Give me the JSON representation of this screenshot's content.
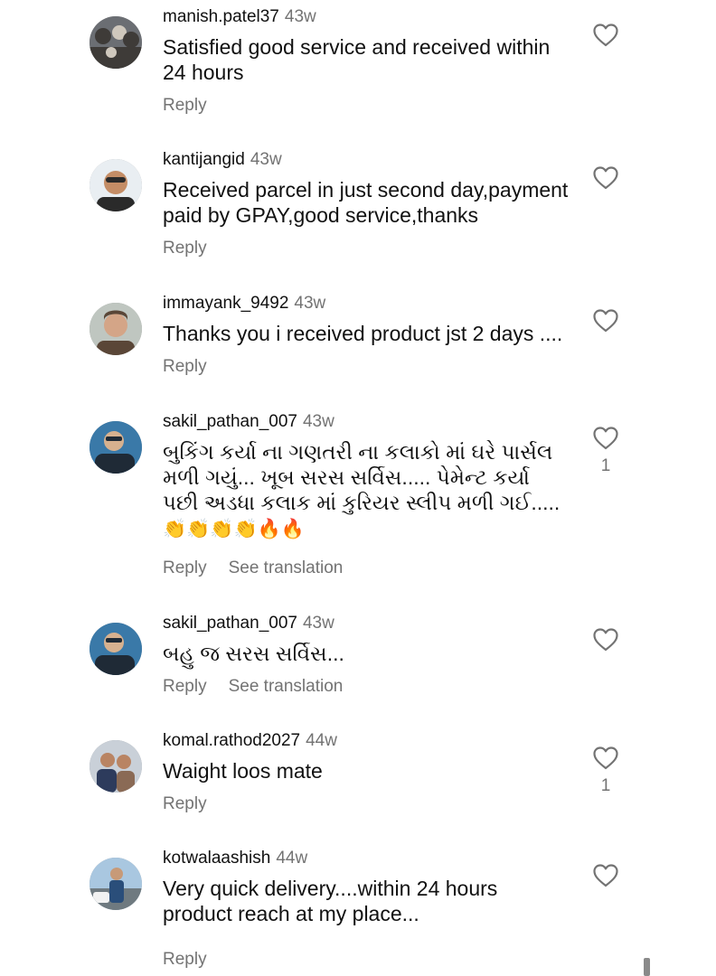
{
  "comments": [
    {
      "username": "manish.patel37",
      "time": "43w",
      "text": "Satisfied  good service and received within 24 hours",
      "reply": "Reply",
      "avatar_colors": [
        "#6b6e73",
        "#3e3b38",
        "#cfc8bd"
      ]
    },
    {
      "username": "kantijangid",
      "time": "43w",
      "text": "Received parcel in just second day,payment paid by GPAY,good service,thanks",
      "reply": "Reply",
      "avatar_colors": [
        "#e9eef2",
        "#2a2a2a",
        "#c48d66"
      ]
    },
    {
      "username": "immayank_9492",
      "time": "43w",
      "text": "Thanks you i received product jst 2 days ....",
      "reply": "Reply",
      "avatar_colors": [
        "#bfc6c0",
        "#5a4637",
        "#d4a587"
      ]
    },
    {
      "username": "sakil_pathan_007",
      "time": "43w",
      "text": "બુકિંગ કર્યા ના ગણતરી ના કલાકો માં ઘરે પાર્સલ મળી ગયું... ખૂબ સરસ સર્વિસ..... પેમેન્ટ કર્યા પછી અડધા કલાક માં કુરિયર સ્લીપ મળી ગઈ.....",
      "emojis": "👏👏👏👏🔥🔥",
      "reply": "Reply",
      "see_translation": "See translation",
      "likes": "1",
      "avatar_colors": [
        "#3a79a8",
        "#1f2a36",
        "#d7b18f"
      ]
    },
    {
      "username": "sakil_pathan_007",
      "time": "43w",
      "text": "બહુ જ સરસ સર્વિસ...",
      "reply": "Reply",
      "see_translation": "See translation",
      "avatar_colors": [
        "#3a79a8",
        "#1f2a36",
        "#d7b18f"
      ]
    },
    {
      "username": "komal.rathod2027",
      "time": "44w",
      "text": "Waight loos mate",
      "reply": "Reply",
      "likes": "1",
      "avatar_colors": [
        "#c9d0d8",
        "#2d3b5c",
        "#b98463"
      ]
    },
    {
      "username": "kotwalaashish",
      "time": "44w",
      "text": "Very quick delivery....within 24 hours product reach at my place...",
      "reply": "Reply",
      "avatar_colors": [
        "#a9c7e0",
        "#2a4e7a",
        "#c79a78"
      ]
    }
  ]
}
